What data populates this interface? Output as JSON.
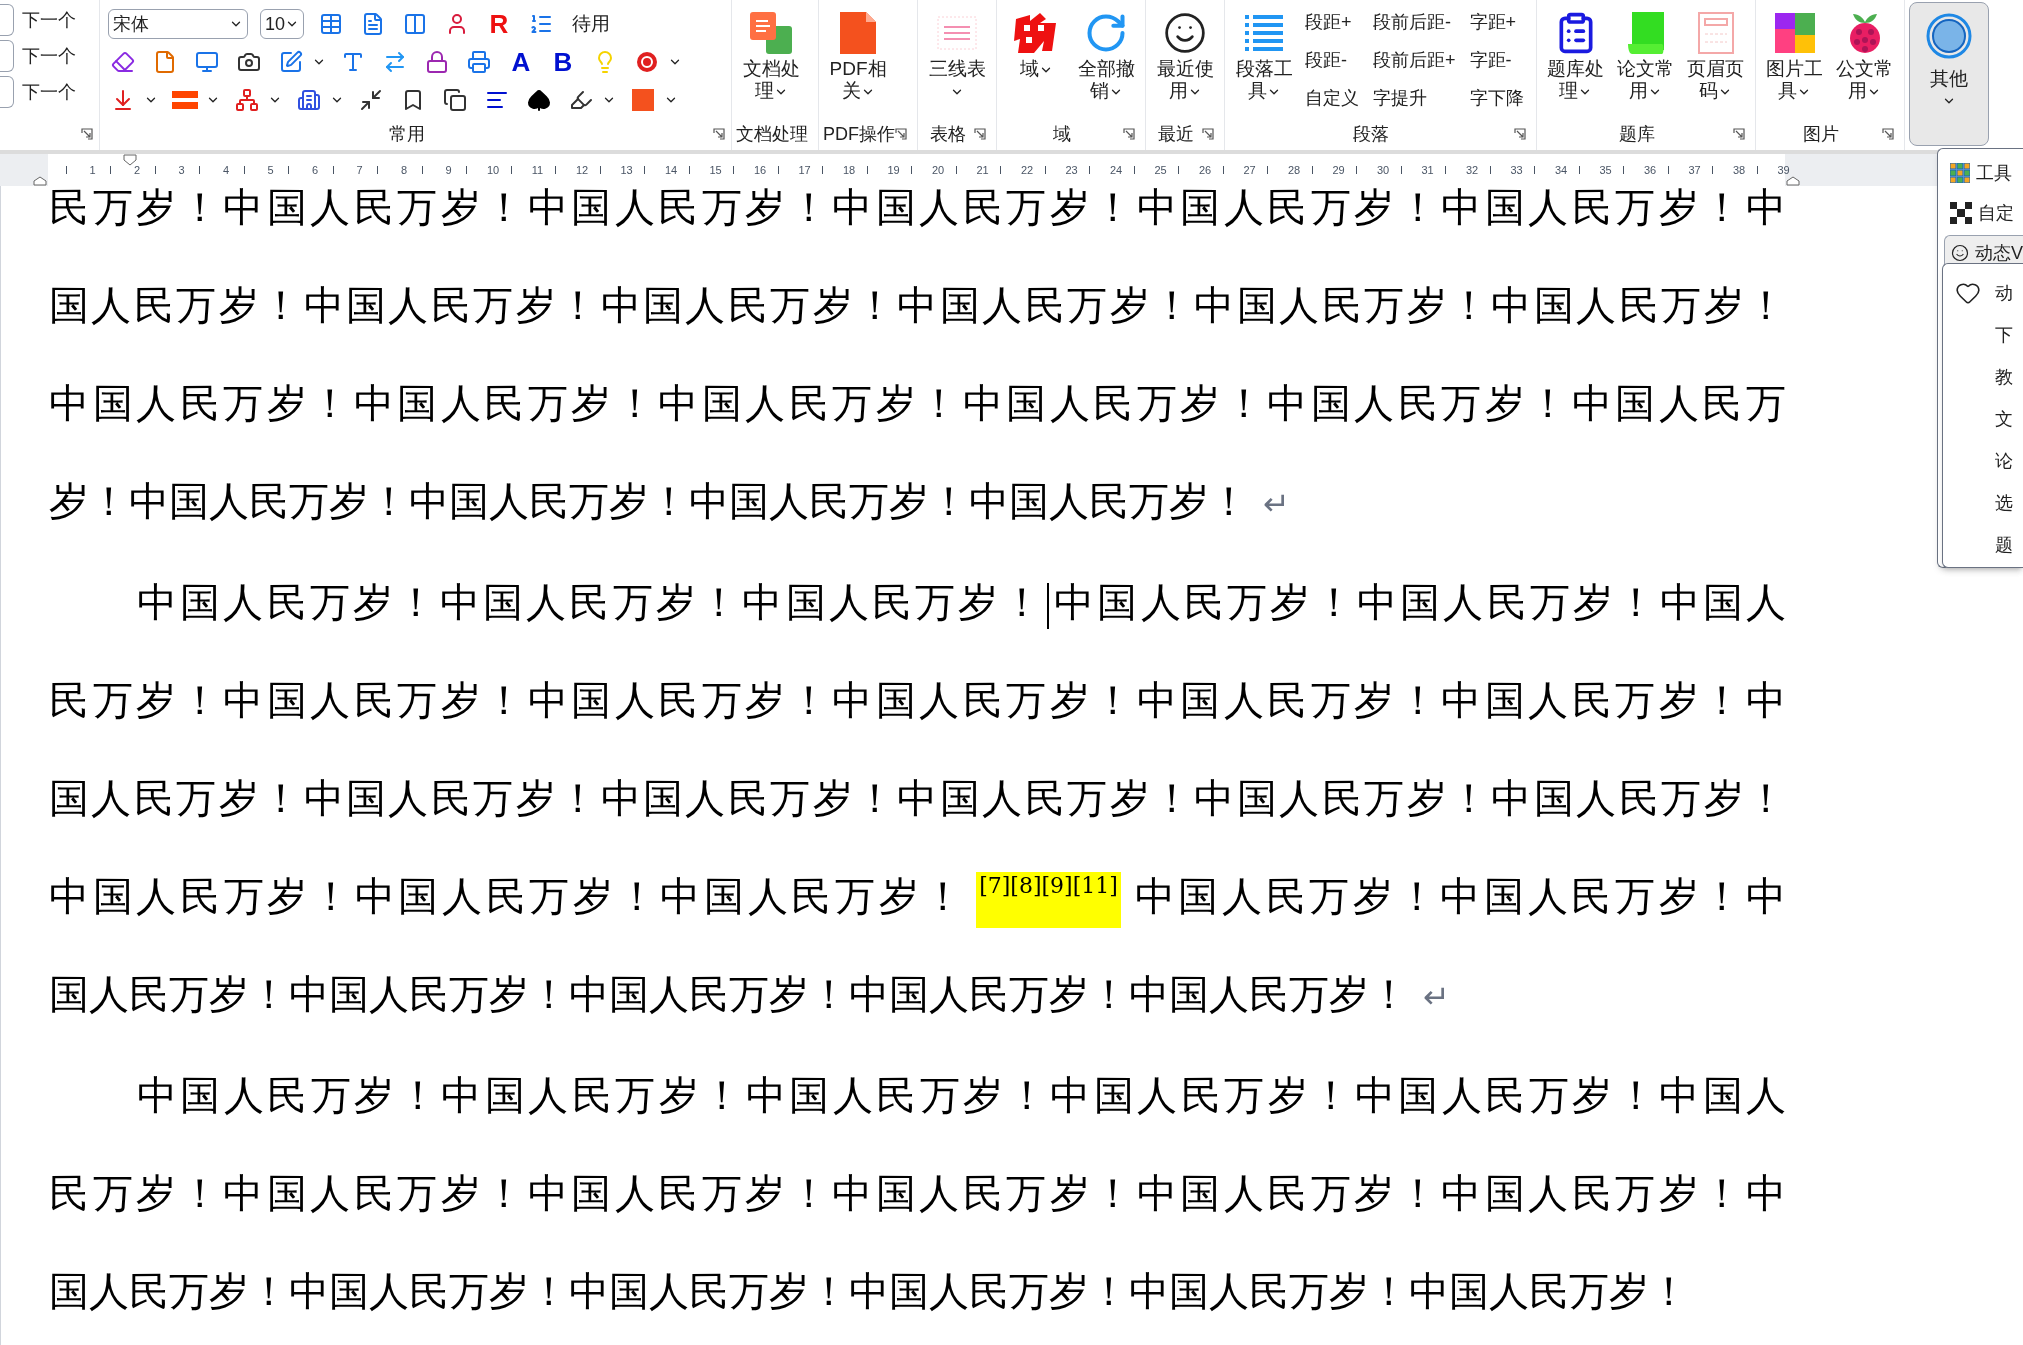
{
  "ribbon": {
    "nav": [
      "下一个",
      "下一个",
      "下一个"
    ],
    "common": {
      "label": "常用",
      "font": "宋体",
      "size": "10",
      "rows": [
        [
          {
            "kind": "icon",
            "dropdown": false
          },
          {
            "kind": "icon",
            "dropdown": false
          },
          {
            "kind": "icon",
            "dropdown": false
          },
          {
            "kind": "icon",
            "dropdown": false
          },
          {
            "kind": "letter",
            "text": "R",
            "color": "#ee1111"
          },
          {
            "kind": "icon",
            "dropdown": false
          },
          {
            "kind": "label",
            "text": "待用"
          }
        ],
        [
          {
            "kind": "icon",
            "dropdown": false
          },
          {
            "kind": "icon",
            "dropdown": false
          },
          {
            "kind": "icon",
            "dropdown": false
          },
          {
            "kind": "icon",
            "dropdown": false
          },
          {
            "kind": "icon",
            "dropdown": true
          },
          {
            "kind": "icon",
            "dropdown": false
          },
          {
            "kind": "icon",
            "dropdown": false
          },
          {
            "kind": "icon",
            "dropdown": false
          },
          {
            "kind": "icon",
            "dropdown": false
          },
          {
            "kind": "letter",
            "text": "A",
            "color": "#0010d0"
          },
          {
            "kind": "letter",
            "text": "B",
            "color": "#0010d0"
          },
          {
            "kind": "icon",
            "dropdown": false
          },
          {
            "kind": "icon",
            "dropdown": true
          }
        ],
        [
          {
            "kind": "icon",
            "dropdown": true
          },
          {
            "kind": "icon",
            "dropdown": true
          },
          {
            "kind": "icon",
            "dropdown": true
          },
          {
            "kind": "icon",
            "dropdown": true
          },
          {
            "kind": "icon",
            "dropdown": false
          },
          {
            "kind": "icon",
            "dropdown": false
          },
          {
            "kind": "icon",
            "dropdown": false
          },
          {
            "kind": "icon",
            "dropdown": false
          },
          {
            "kind": "icon",
            "dropdown": false
          },
          {
            "kind": "icon",
            "dropdown": true
          },
          {
            "kind": "icon",
            "dropdown": true
          }
        ]
      ]
    },
    "groups": [
      {
        "label": "文档处理",
        "launcher": false,
        "buttons": [
          {
            "label": "文档处理",
            "dropdown": true
          }
        ]
      },
      {
        "label": "PDF操作",
        "launcher": true,
        "buttons": [
          {
            "label": "PDF相关",
            "dropdown": true
          }
        ]
      },
      {
        "label": "表格",
        "launcher": true,
        "buttons": [
          {
            "label": "三线表",
            "dropdown": true
          }
        ]
      },
      {
        "label": "域",
        "launcher": true,
        "buttons": [
          {
            "label": "域",
            "dropdown": true
          },
          {
            "label": "全部撤销",
            "dropdown": true
          }
        ]
      },
      {
        "label": "最近",
        "launcher": true,
        "buttons": [
          {
            "label": "最近使用",
            "dropdown": true
          }
        ]
      },
      {
        "label": "段落",
        "launcher": true,
        "buttons": [
          {
            "label": "段落工具",
            "dropdown": true
          }
        ],
        "small": [
          [
            "段距+",
            "段距-",
            "自定义"
          ],
          [
            "段前后距-",
            "段前后距+",
            "字提升"
          ],
          [
            "字距+",
            "字距-",
            "字下降"
          ]
        ]
      },
      {
        "label": "题库",
        "launcher": true,
        "buttons": [
          {
            "label": "题库处理",
            "dropdown": true
          },
          {
            "label": "论文常用",
            "dropdown": true
          },
          {
            "label": "页眉页码",
            "dropdown": true
          }
        ]
      },
      {
        "label": "图片",
        "launcher": true,
        "buttons": [
          {
            "label": "图片工具",
            "dropdown": true
          },
          {
            "label": "公文常用",
            "dropdown": true
          }
        ]
      }
    ],
    "other": {
      "label": "其他",
      "selected": true,
      "dropdown": true
    }
  },
  "ruler": {
    "numbers": [
      "1",
      "2",
      "3",
      "4",
      "5",
      "6",
      "7",
      "8",
      "9",
      "10",
      "11",
      "12",
      "13",
      "14",
      "15",
      "16",
      "17",
      "18",
      "19",
      "20",
      "21",
      "22",
      "23",
      "24",
      "25",
      "26",
      "27",
      "28",
      "29",
      "30",
      "31",
      "32",
      "33",
      "34",
      "35",
      "36",
      "37",
      "38",
      "39"
    ]
  },
  "document": {
    "paragraphs": [
      {
        "indent": false,
        "end_mark": "↵",
        "lines": [
          [
            {
              "kind": "text",
              "text": "民万岁！中国人民万岁！中国人民万岁！中国人民万岁！中国人民万岁！中国人民万岁！中"
            }
          ],
          [
            {
              "kind": "text",
              "text": "国人民万岁！中国人民万岁！中国人民万岁！中国人民万岁！中国人民万岁！中国人民万岁！"
            }
          ],
          [
            {
              "kind": "text",
              "text": "中国人民万岁！中国人民万岁！中国人民万岁！中国人民万岁！中国人民万岁！中国人民万"
            }
          ],
          [
            {
              "kind": "text",
              "text": "岁！中国人民万岁！中国人民万岁！中国人民万岁！中国人民万岁！"
            }
          ]
        ]
      },
      {
        "indent": true,
        "end_mark": "↵",
        "lines": [
          [
            {
              "kind": "text",
              "text": "中国人民万岁！中国人民万岁！中国人民万岁！"
            },
            {
              "kind": "cursor"
            },
            {
              "kind": "text",
              "text": "中国人民万岁！中国人民万岁！中国人"
            }
          ],
          [
            {
              "kind": "text",
              "text": "民万岁！中国人民万岁！中国人民万岁！中国人民万岁！中国人民万岁！中国人民万岁！中"
            }
          ],
          [
            {
              "kind": "text",
              "text": "国人民万岁！中国人民万岁！中国人民万岁！中国人民万岁！中国人民万岁！中国人民万岁！"
            }
          ],
          [
            {
              "kind": "text",
              "text": "中国人民万岁！中国人民万岁！中国人民万岁！"
            },
            {
              "kind": "highlight",
              "text": "[7][8][9][11]"
            },
            {
              "kind": "text",
              "text": "中国人民万岁！中国人民万岁！中"
            }
          ],
          [
            {
              "kind": "text",
              "text": "国人民万岁！中国人民万岁！中国人民万岁！中国人民万岁！中国人民万岁！"
            }
          ]
        ]
      },
      {
        "indent": true,
        "lines": [
          [
            {
              "kind": "text",
              "text": "中国人民万岁！中国人民万岁！中国人民万岁！中国人民万岁！中国人民万岁！中国人"
            }
          ],
          [
            {
              "kind": "text",
              "text": "民万岁！中国人民万岁！中国人民万岁！中国人民万岁！中国人民万岁！中国人民万岁！中"
            }
          ],
          [
            {
              "kind": "text",
              "text": "国人民万岁！中国人民万岁！中国人民万岁！中国人民万岁！中国人民万岁！中国人民万岁！"
            }
          ]
        ]
      }
    ]
  },
  "other_menu": {
    "items": [
      {
        "label": "工具",
        "selected": false
      },
      {
        "label": "自定",
        "selected": false
      },
      {
        "label": "动态V",
        "selected": true
      }
    ],
    "submenu": [
      "动",
      "下",
      "教",
      "文",
      "论",
      "选",
      "题"
    ]
  }
}
